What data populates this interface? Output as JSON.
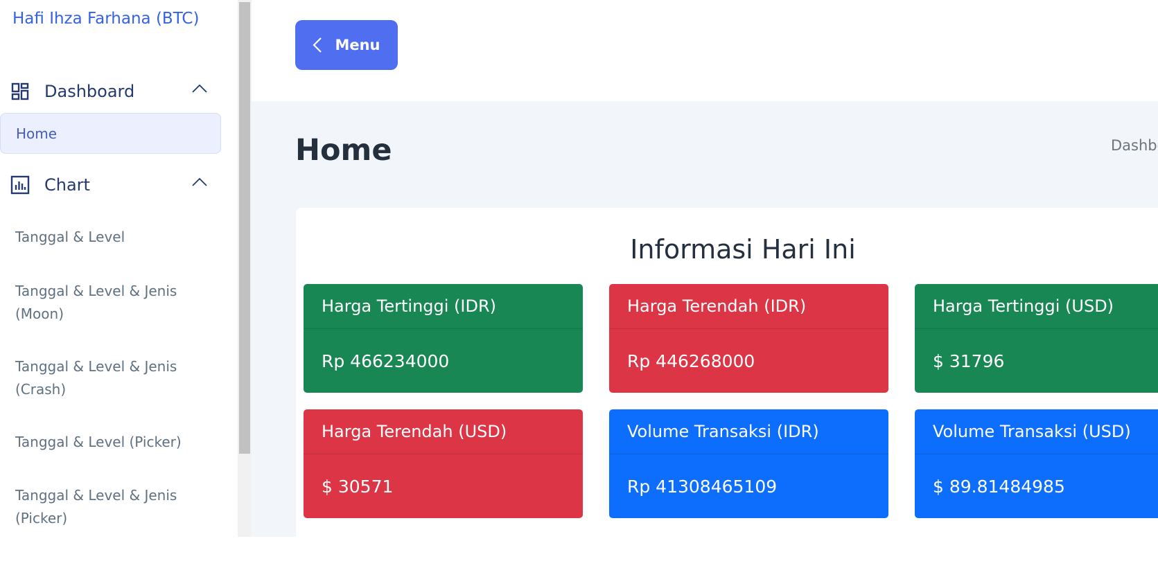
{
  "sidebar": {
    "brand": "Hafi Ihza Farhana (BTC)",
    "sections": [
      {
        "label": "Dashboard",
        "icon": "dashboard-grid-icon",
        "items": [
          "Home"
        ]
      },
      {
        "label": "Chart",
        "icon": "bar-chart-icon",
        "items": [
          "Tanggal & Level",
          "Tanggal & Level & Jenis (Moon)",
          "Tanggal & Level & Jenis (Crash)",
          "Tanggal & Level (Picker)",
          "Tanggal & Level & Jenis (Picker)"
        ]
      }
    ],
    "active_item": "Home"
  },
  "topbar": {
    "menu_label": "Menu",
    "menu_icon": "chevron-left-icon"
  },
  "page": {
    "title": "Home",
    "breadcrumb": "Dashboard"
  },
  "info_section": {
    "title": "Informasi Hari Ini",
    "cards": [
      {
        "label": "Harga Tertinggi (IDR)",
        "value": "Rp 466234000",
        "color": "#198754"
      },
      {
        "label": "Harga Terendah (IDR)",
        "value": "Rp 446268000",
        "color": "#dc3545"
      },
      {
        "label": "Harga Tertinggi (USD)",
        "value": "$ 31796",
        "color": "#198754"
      },
      {
        "label": "Harga Terendah (USD)",
        "value": "$ 30571",
        "color": "#dc3545"
      },
      {
        "label": "Volume Transaksi (IDR)",
        "value": "Rp 41308465109",
        "color": "#0d6efd"
      },
      {
        "label": "Volume Transaksi (USD)",
        "value": "$ 89.81484985",
        "color": "#0d6efd"
      }
    ]
  },
  "colors": {
    "accent": "#435ebe",
    "menu_button": "#4f6ff0",
    "main_background": "#f2f5f9"
  }
}
